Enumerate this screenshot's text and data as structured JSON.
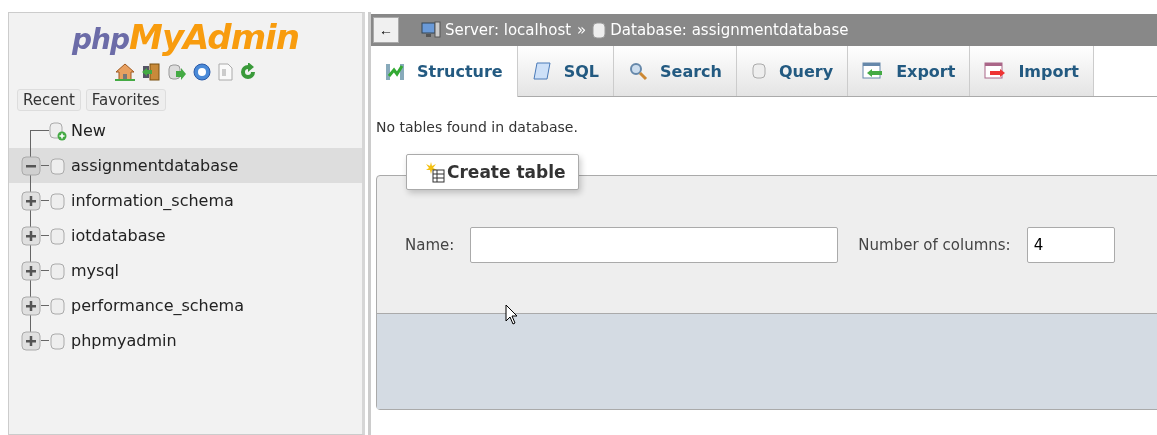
{
  "logo": {
    "part1": "php",
    "part2": "MyAdmin"
  },
  "nav_tabs": [
    {
      "label": "Recent"
    },
    {
      "label": "Favorites"
    }
  ],
  "tree": [
    {
      "label": "New",
      "kind": "new",
      "selected": false
    },
    {
      "label": "assignmentdatabase",
      "kind": "db",
      "selected": true,
      "expanded": true
    },
    {
      "label": "information_schema",
      "kind": "db",
      "selected": false,
      "expanded": false
    },
    {
      "label": "iotdatabase",
      "kind": "db",
      "selected": false,
      "expanded": false
    },
    {
      "label": "mysql",
      "kind": "db",
      "selected": false,
      "expanded": false
    },
    {
      "label": "performance_schema",
      "kind": "db",
      "selected": false,
      "expanded": false
    },
    {
      "label": "phpmyadmin",
      "kind": "db",
      "selected": false,
      "expanded": false
    }
  ],
  "collapse_button": "←",
  "breadcrumb": {
    "server": "Server: localhost",
    "separator": "»",
    "database": "Database: assignmentdatabase"
  },
  "tabs": [
    {
      "label": "Structure",
      "kind": "structure",
      "selected": true
    },
    {
      "label": "SQL",
      "kind": "sql",
      "selected": false
    },
    {
      "label": "Search",
      "kind": "search",
      "selected": false
    },
    {
      "label": "Query",
      "kind": "query",
      "selected": false
    },
    {
      "label": "Export",
      "kind": "export",
      "selected": false
    },
    {
      "label": "Import",
      "kind": "import",
      "selected": false
    }
  ],
  "message": "No tables found in database.",
  "create_table": {
    "legend": "Create table",
    "name_label": "Name:",
    "columns_label": "Number of columns:",
    "columns_value": "4"
  }
}
